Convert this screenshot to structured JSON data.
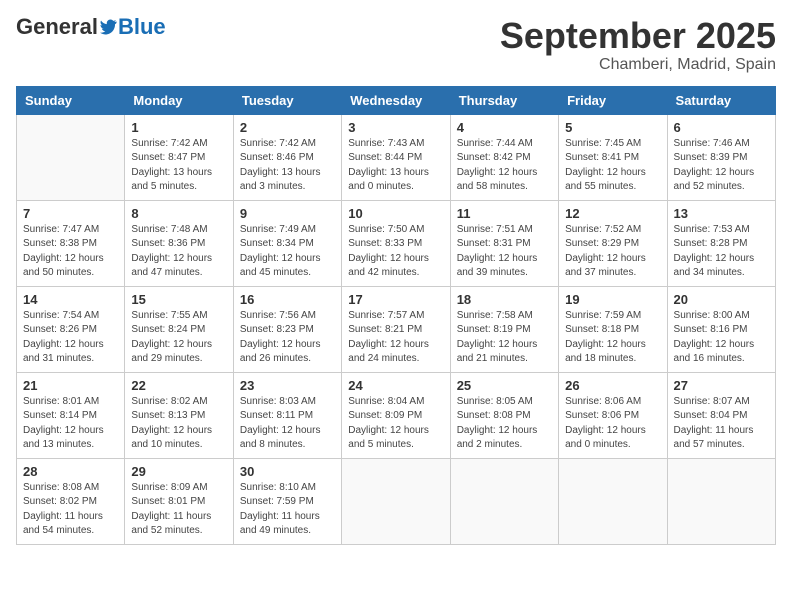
{
  "logo": {
    "general": "General",
    "blue": "Blue"
  },
  "header": {
    "month": "September 2025",
    "location": "Chamberi, Madrid, Spain"
  },
  "weekdays": [
    "Sunday",
    "Monday",
    "Tuesday",
    "Wednesday",
    "Thursday",
    "Friday",
    "Saturday"
  ],
  "weeks": [
    [
      {
        "day": "",
        "sunrise": "",
        "sunset": "",
        "daylight": ""
      },
      {
        "day": "1",
        "sunrise": "Sunrise: 7:42 AM",
        "sunset": "Sunset: 8:47 PM",
        "daylight": "Daylight: 13 hours and 5 minutes."
      },
      {
        "day": "2",
        "sunrise": "Sunrise: 7:42 AM",
        "sunset": "Sunset: 8:46 PM",
        "daylight": "Daylight: 13 hours and 3 minutes."
      },
      {
        "day": "3",
        "sunrise": "Sunrise: 7:43 AM",
        "sunset": "Sunset: 8:44 PM",
        "daylight": "Daylight: 13 hours and 0 minutes."
      },
      {
        "day": "4",
        "sunrise": "Sunrise: 7:44 AM",
        "sunset": "Sunset: 8:42 PM",
        "daylight": "Daylight: 12 hours and 58 minutes."
      },
      {
        "day": "5",
        "sunrise": "Sunrise: 7:45 AM",
        "sunset": "Sunset: 8:41 PM",
        "daylight": "Daylight: 12 hours and 55 minutes."
      },
      {
        "day": "6",
        "sunrise": "Sunrise: 7:46 AM",
        "sunset": "Sunset: 8:39 PM",
        "daylight": "Daylight: 12 hours and 52 minutes."
      }
    ],
    [
      {
        "day": "7",
        "sunrise": "Sunrise: 7:47 AM",
        "sunset": "Sunset: 8:38 PM",
        "daylight": "Daylight: 12 hours and 50 minutes."
      },
      {
        "day": "8",
        "sunrise": "Sunrise: 7:48 AM",
        "sunset": "Sunset: 8:36 PM",
        "daylight": "Daylight: 12 hours and 47 minutes."
      },
      {
        "day": "9",
        "sunrise": "Sunrise: 7:49 AM",
        "sunset": "Sunset: 8:34 PM",
        "daylight": "Daylight: 12 hours and 45 minutes."
      },
      {
        "day": "10",
        "sunrise": "Sunrise: 7:50 AM",
        "sunset": "Sunset: 8:33 PM",
        "daylight": "Daylight: 12 hours and 42 minutes."
      },
      {
        "day": "11",
        "sunrise": "Sunrise: 7:51 AM",
        "sunset": "Sunset: 8:31 PM",
        "daylight": "Daylight: 12 hours and 39 minutes."
      },
      {
        "day": "12",
        "sunrise": "Sunrise: 7:52 AM",
        "sunset": "Sunset: 8:29 PM",
        "daylight": "Daylight: 12 hours and 37 minutes."
      },
      {
        "day": "13",
        "sunrise": "Sunrise: 7:53 AM",
        "sunset": "Sunset: 8:28 PM",
        "daylight": "Daylight: 12 hours and 34 minutes."
      }
    ],
    [
      {
        "day": "14",
        "sunrise": "Sunrise: 7:54 AM",
        "sunset": "Sunset: 8:26 PM",
        "daylight": "Daylight: 12 hours and 31 minutes."
      },
      {
        "day": "15",
        "sunrise": "Sunrise: 7:55 AM",
        "sunset": "Sunset: 8:24 PM",
        "daylight": "Daylight: 12 hours and 29 minutes."
      },
      {
        "day": "16",
        "sunrise": "Sunrise: 7:56 AM",
        "sunset": "Sunset: 8:23 PM",
        "daylight": "Daylight: 12 hours and 26 minutes."
      },
      {
        "day": "17",
        "sunrise": "Sunrise: 7:57 AM",
        "sunset": "Sunset: 8:21 PM",
        "daylight": "Daylight: 12 hours and 24 minutes."
      },
      {
        "day": "18",
        "sunrise": "Sunrise: 7:58 AM",
        "sunset": "Sunset: 8:19 PM",
        "daylight": "Daylight: 12 hours and 21 minutes."
      },
      {
        "day": "19",
        "sunrise": "Sunrise: 7:59 AM",
        "sunset": "Sunset: 8:18 PM",
        "daylight": "Daylight: 12 hours and 18 minutes."
      },
      {
        "day": "20",
        "sunrise": "Sunrise: 8:00 AM",
        "sunset": "Sunset: 8:16 PM",
        "daylight": "Daylight: 12 hours and 16 minutes."
      }
    ],
    [
      {
        "day": "21",
        "sunrise": "Sunrise: 8:01 AM",
        "sunset": "Sunset: 8:14 PM",
        "daylight": "Daylight: 12 hours and 13 minutes."
      },
      {
        "day": "22",
        "sunrise": "Sunrise: 8:02 AM",
        "sunset": "Sunset: 8:13 PM",
        "daylight": "Daylight: 12 hours and 10 minutes."
      },
      {
        "day": "23",
        "sunrise": "Sunrise: 8:03 AM",
        "sunset": "Sunset: 8:11 PM",
        "daylight": "Daylight: 12 hours and 8 minutes."
      },
      {
        "day": "24",
        "sunrise": "Sunrise: 8:04 AM",
        "sunset": "Sunset: 8:09 PM",
        "daylight": "Daylight: 12 hours and 5 minutes."
      },
      {
        "day": "25",
        "sunrise": "Sunrise: 8:05 AM",
        "sunset": "Sunset: 8:08 PM",
        "daylight": "Daylight: 12 hours and 2 minutes."
      },
      {
        "day": "26",
        "sunrise": "Sunrise: 8:06 AM",
        "sunset": "Sunset: 8:06 PM",
        "daylight": "Daylight: 12 hours and 0 minutes."
      },
      {
        "day": "27",
        "sunrise": "Sunrise: 8:07 AM",
        "sunset": "Sunset: 8:04 PM",
        "daylight": "Daylight: 11 hours and 57 minutes."
      }
    ],
    [
      {
        "day": "28",
        "sunrise": "Sunrise: 8:08 AM",
        "sunset": "Sunset: 8:02 PM",
        "daylight": "Daylight: 11 hours and 54 minutes."
      },
      {
        "day": "29",
        "sunrise": "Sunrise: 8:09 AM",
        "sunset": "Sunset: 8:01 PM",
        "daylight": "Daylight: 11 hours and 52 minutes."
      },
      {
        "day": "30",
        "sunrise": "Sunrise: 8:10 AM",
        "sunset": "Sunset: 7:59 PM",
        "daylight": "Daylight: 11 hours and 49 minutes."
      },
      {
        "day": "",
        "sunrise": "",
        "sunset": "",
        "daylight": ""
      },
      {
        "day": "",
        "sunrise": "",
        "sunset": "",
        "daylight": ""
      },
      {
        "day": "",
        "sunrise": "",
        "sunset": "",
        "daylight": ""
      },
      {
        "day": "",
        "sunrise": "",
        "sunset": "",
        "daylight": ""
      }
    ]
  ]
}
